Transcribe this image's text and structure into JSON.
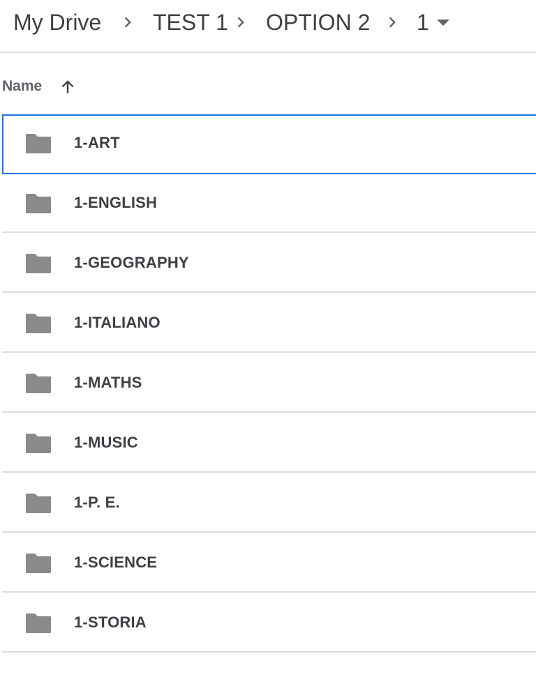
{
  "breadcrumb": {
    "items": [
      "My Drive",
      "TEST 1",
      "OPTION 2",
      "1"
    ]
  },
  "header": {
    "name_label": "Name",
    "sort_direction": "ascending"
  },
  "folders": [
    {
      "name": "1-ART",
      "selected": true
    },
    {
      "name": "1-ENGLISH",
      "selected": false
    },
    {
      "name": "1-GEOGRAPHY",
      "selected": false
    },
    {
      "name": "1-ITALIANO",
      "selected": false
    },
    {
      "name": "1-MATHS",
      "selected": false
    },
    {
      "name": "1-MUSIC",
      "selected": false
    },
    {
      "name": "1-P. E.",
      "selected": false
    },
    {
      "name": "1-SCIENCE",
      "selected": false
    },
    {
      "name": "1-STORIA",
      "selected": false
    }
  ],
  "colors": {
    "folder_icon": "#8a8a8a",
    "selection_border": "#1a73e8",
    "divider": "#dadce0"
  }
}
